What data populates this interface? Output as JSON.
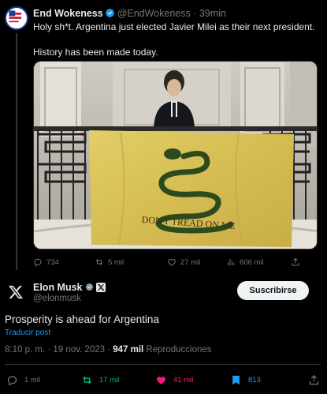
{
  "quoted": {
    "name": "End Wokeness",
    "handle": "@EndWokeness",
    "separator": " · ",
    "time": "39min",
    "line1": "Holy sh*t. Argentina just elected Javier Milei as their next president.",
    "line2": "History has been made today.",
    "image_flag_text": "DON'T TREAD ON ME",
    "replies": "734",
    "reposts": "5 mil",
    "likes": "27 mil",
    "views": "606 mil"
  },
  "tweet": {
    "name": "Elon Musk",
    "handle": "@elonmusk",
    "subscribe_label": "Suscribirse",
    "text": "Prosperity is ahead for Argentina",
    "translate_label": "Traducir post",
    "time": "8:10 p. m. · 19 nov. 2023 · ",
    "views_count": "947 mil",
    "views_label": " Reproducciones",
    "replies": "1 mil",
    "reposts": "17 mil",
    "likes": "41 mil",
    "bookmarks": "813"
  },
  "colors": {
    "background": "#000000",
    "text": "#e7e9ea",
    "muted": "#71767b",
    "accent": "#1d9bf0",
    "repost_active": "#00ba7c",
    "like_active": "#f91880",
    "bookmark_active": "#1d9bf0",
    "flag": "#d8c25a"
  },
  "icons": [
    "verified-badge-icon",
    "x-logo-icon",
    "reply-icon",
    "repost-icon",
    "like-icon",
    "views-icon",
    "bookmark-icon"
  ]
}
